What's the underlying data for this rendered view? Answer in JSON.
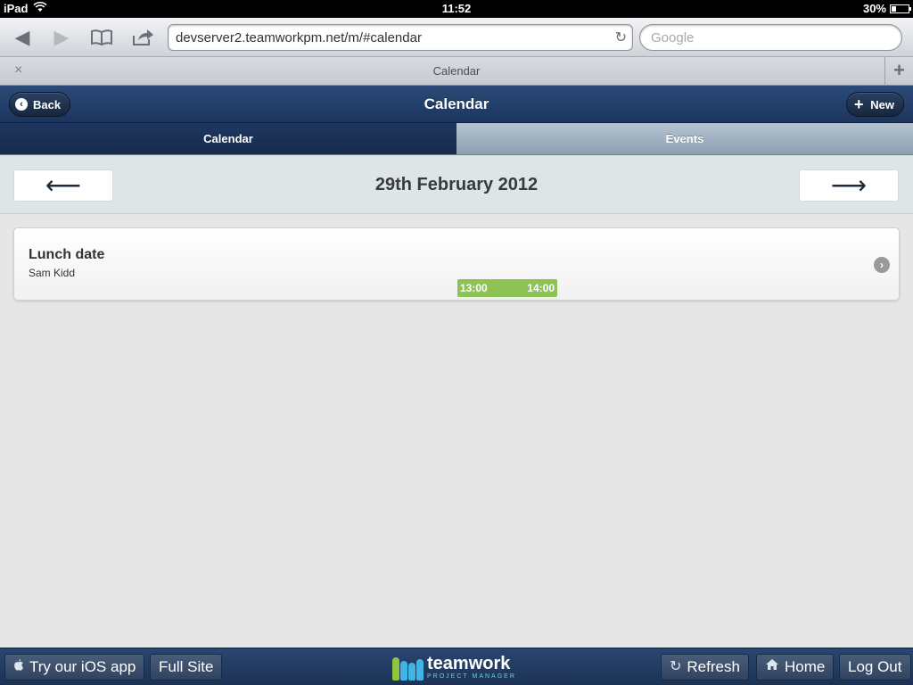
{
  "status_bar": {
    "device": "iPad",
    "time": "11:52",
    "battery": "30%",
    "battery_level": 0.3
  },
  "browser": {
    "url": "devserver2.teamworkpm.net/m/#calendar",
    "search_placeholder": "Google",
    "tab_title": "Calendar",
    "tab_close": "×",
    "new_tab": "+"
  },
  "header": {
    "title": "Calendar",
    "back_label": "Back",
    "new_label": "New"
  },
  "tabs": [
    {
      "label": "Calendar",
      "active": true
    },
    {
      "label": "Events",
      "active": false
    }
  ],
  "date_nav": {
    "date": "29th February 2012",
    "prev": "⟵",
    "next": "⟶"
  },
  "events": [
    {
      "title": "Lunch date",
      "person": "Sam Kidd",
      "start": "13:00",
      "end": "14:00",
      "color": "#8dc255"
    }
  ],
  "footer": {
    "ios_app": "Try our iOS app",
    "full_site": "Full Site",
    "logo_text": "teamwork",
    "logo_sub": "PROJECT MANAGER",
    "refresh": "Refresh",
    "home": "Home",
    "logout": "Log Out"
  },
  "colors": {
    "header": "#1c355d",
    "event": "#8dc255",
    "datebar": "#dde5e7"
  }
}
